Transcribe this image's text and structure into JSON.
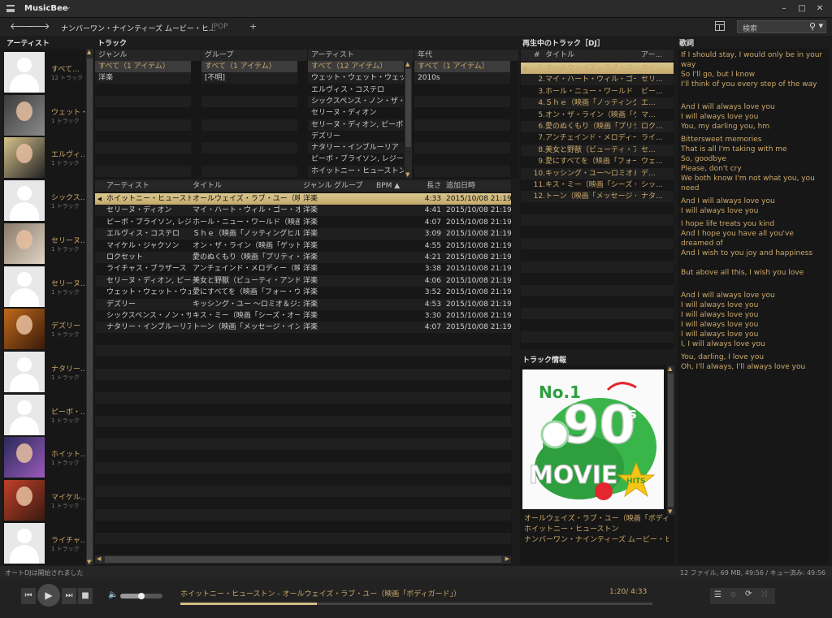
{
  "app": {
    "title": "MusicBee"
  },
  "tabs": [
    "ナンバーワン・ナインティーズ ムービー・ヒ...",
    "JPOP",
    "+"
  ],
  "search": {
    "placeholder": "検索"
  },
  "headers": {
    "artists": "アーティスト",
    "tracks": "トラック",
    "nowplaying": "再生中のトラック［DJ］",
    "lyrics": "歌詞",
    "trackinfo": "トラック情報"
  },
  "filters": {
    "genre": {
      "header": "ジャンル",
      "items": [
        "すべて（1 アイテム）",
        "洋楽"
      ]
    },
    "group": {
      "header": "グループ",
      "items": [
        "すべて（1 アイテム）",
        "[不明]"
      ]
    },
    "artist": {
      "header": "アーティスト",
      "items": [
        "すべて（12 アイテム）",
        "ウェット・ウェット・ウェット",
        "エルヴィス・コステロ",
        "シックスペンス・ノン・ザ・リッチャ...",
        "セリーヌ・ディオン",
        "セリーヌ・ディオン, ピーボ・ブライソン",
        "デズリー",
        "ナタリー・インブルーリア",
        "ピーボ・ブライソン, レジーナ・ベル",
        "ホイットニー・ヒューストン"
      ]
    },
    "year": {
      "header": "年代",
      "items": [
        "すべて（1 アイテム）",
        "2010s"
      ]
    }
  },
  "artists": [
    {
      "name": "すべて...",
      "count": "12 トラック",
      "img": "placeholder"
    },
    {
      "name": "ウェット・...",
      "count": "1 トラック",
      "img": "photo1"
    },
    {
      "name": "エルヴィ...",
      "count": "1 トラック",
      "img": "photo2"
    },
    {
      "name": "シックス...",
      "count": "1 トラック",
      "img": "placeholder"
    },
    {
      "name": "セリーヌ...",
      "count": "1 トラック",
      "img": "photo3"
    },
    {
      "name": "セリーヌ...",
      "count": "1 トラック",
      "img": "placeholder"
    },
    {
      "name": "デズリー",
      "count": "1 トラック",
      "img": "photo4"
    },
    {
      "name": "ナタリー...",
      "count": "1 トラック",
      "img": "placeholder"
    },
    {
      "name": "ピーボ・...",
      "count": "1 トラック",
      "img": "placeholder"
    },
    {
      "name": "ホイット...",
      "count": "1 トラック",
      "img": "photo5"
    },
    {
      "name": "マイケル...",
      "count": "1 トラック",
      "img": "photo6"
    },
    {
      "name": "ライチャ...",
      "count": "1 トラック",
      "img": "placeholder"
    }
  ],
  "tracklist": {
    "columns": [
      "アーティスト",
      "タイトル",
      "ジャンル",
      "グループ",
      "BPM ▲",
      "長さ",
      "追加日時"
    ],
    "rows": [
      [
        "ホイットニー・ヒューストン",
        "オールウェイズ・ラブ・ユー（映画「ボ...",
        "洋楽",
        "4:33",
        "2015/10/08 21:19"
      ],
      [
        "セリーヌ・ディオン",
        "マイ・ハート・ウィル・ゴー・オン（映画...",
        "洋楽",
        "4:41",
        "2015/10/08 21:19"
      ],
      [
        "ピーボ・ブライソン, レジ...",
        "ホール・ニュー・ワールド（映画「ア...",
        "洋楽",
        "4:07",
        "2015/10/08 21:19"
      ],
      [
        "エルヴィス・コステロ",
        "Ｓｈｅ（映画「ノッティングヒルの...",
        "洋楽",
        "3:09",
        "2015/10/08 21:19"
      ],
      [
        "マイケル・ジャクソン",
        "オン・ザ・ライン（映画「ゲット・オン...",
        "洋楽",
        "4:55",
        "2015/10/08 21:19"
      ],
      [
        "ロクセット",
        "愛のぬくもり（映画「プリティ・ウー...",
        "洋楽",
        "4:21",
        "2015/10/08 21:19"
      ],
      [
        "ライチャス・ブラザース",
        "アンチェインド・メロディー（映画「...",
        "洋楽",
        "3:38",
        "2015/10/08 21:19"
      ],
      [
        "セリーヌ・ディオン, ピー...",
        "美女と野獣（ビューティ・アンド・...",
        "洋楽",
        "4:06",
        "2015/10/08 21:19"
      ],
      [
        "ウェット・ウェット・ウェット",
        "愛にすべてを（映画「フォー・ウェ...",
        "洋楽",
        "3:52",
        "2015/10/08 21:19"
      ],
      [
        "デズリー",
        "キッシング・ユー ～ロミオ＆ジュリエ...",
        "洋楽",
        "4:53",
        "2015/10/08 21:19"
      ],
      [
        "シックスペンス・ノン・ザ・リ...",
        "キス・ミー（映画「シーズ・オール・...",
        "洋楽",
        "3:30",
        "2015/10/08 21:19"
      ],
      [
        "ナタリー・インブルーリア",
        "トーン（映画「メッセージ・イン・ア...",
        "洋楽",
        "4:07",
        "2015/10/08 21:19"
      ]
    ]
  },
  "nowplaying": {
    "columns": [
      "#",
      "タイトル",
      "アー..."
    ],
    "rows": [
      [
        "1.",
        "オールウェイズ・ラブ・ユー（...",
        "ホイ..."
      ],
      [
        "2.",
        "マイ・ハート・ウィル・ゴー・オン...",
        "セリ..."
      ],
      [
        "3.",
        "ホール・ニュー・ワールド（映...",
        "ピー..."
      ],
      [
        "4.",
        "Ｓｈｅ（映画「ノッティング...",
        "エ..."
      ],
      [
        "5.",
        "オン・ザ・ライン（映画「ゲット...",
        "マ..."
      ],
      [
        "6.",
        "愛のぬくもり（映画「プリティ...",
        "ロク..."
      ],
      [
        "7.",
        "アンチェインド・メロディー（...",
        "ライ..."
      ],
      [
        "8.",
        "美女と野獣（ビューティ・ア...",
        "セ..."
      ],
      [
        "9.",
        "愛にすべてを（映画「フォー・...",
        "ウェ..."
      ],
      [
        "10.",
        "キッシング・ユー～ロミオ＆ジ...",
        "デ..."
      ],
      [
        "11.",
        "キス・ミー（映画「シーズ・オ...",
        "シッ..."
      ],
      [
        "12.",
        "トーン（映画「メッセージ・イ...",
        "ナタ..."
      ]
    ]
  },
  "trackinfo": {
    "art_text": {
      "no1": "No.1",
      "num": "90",
      "s": "s",
      "movie": "MOVIE",
      "hits": "HITS"
    },
    "title": "オールウェイズ・ラブ・ユー（映画「ボディガー...",
    "artist": "ホイットニー・ヒューストン",
    "album": "ナンバーワン・ナインティーズ ムービー・ヒッツ D..."
  },
  "lyrics": [
    "If I should stay, I would only be in your way",
    "So I'll go, but I know",
    "I'll think of you every step of the way",
    "",
    "And I will always love you",
    "I will always love you",
    "You, my darling you, hm",
    "",
    "Bittersweet memories",
    "That is all I'm taking with me",
    "So, goodbye",
    "Please, don't cry",
    "We both know I'm not what you, you need",
    "",
    "And I will always love you",
    "I will always love you",
    "",
    "I hope life treats you kind",
    "And I hope you have all you've dreamed of",
    "And I wish to you joy and happiness",
    "But above all this, I wish you love",
    "",
    "And I will always love you",
    "I will always love you",
    "I will always love you",
    "I will always love you",
    "I will always love you",
    "I, I will always love you",
    "",
    "You, darling, I love you",
    "Oh, I'll always, I'll always love you"
  ],
  "status": {
    "left": "オートDJは開始されました",
    "right": "12 ファイル, 69 MB, 49:56 /   キュー済み: 49:56"
  },
  "player": {
    "now": "ホイットニー・ヒューストン - オールウェイズ・ラブ・ユー（映画「ボディガード」）",
    "time": "1:20/ 4:33",
    "progress": 0.29,
    "volume": 0.5
  },
  "colors": {
    "accent": "#cda96a",
    "bg": "#1c1c1c",
    "highlight": "#d4bd84"
  }
}
